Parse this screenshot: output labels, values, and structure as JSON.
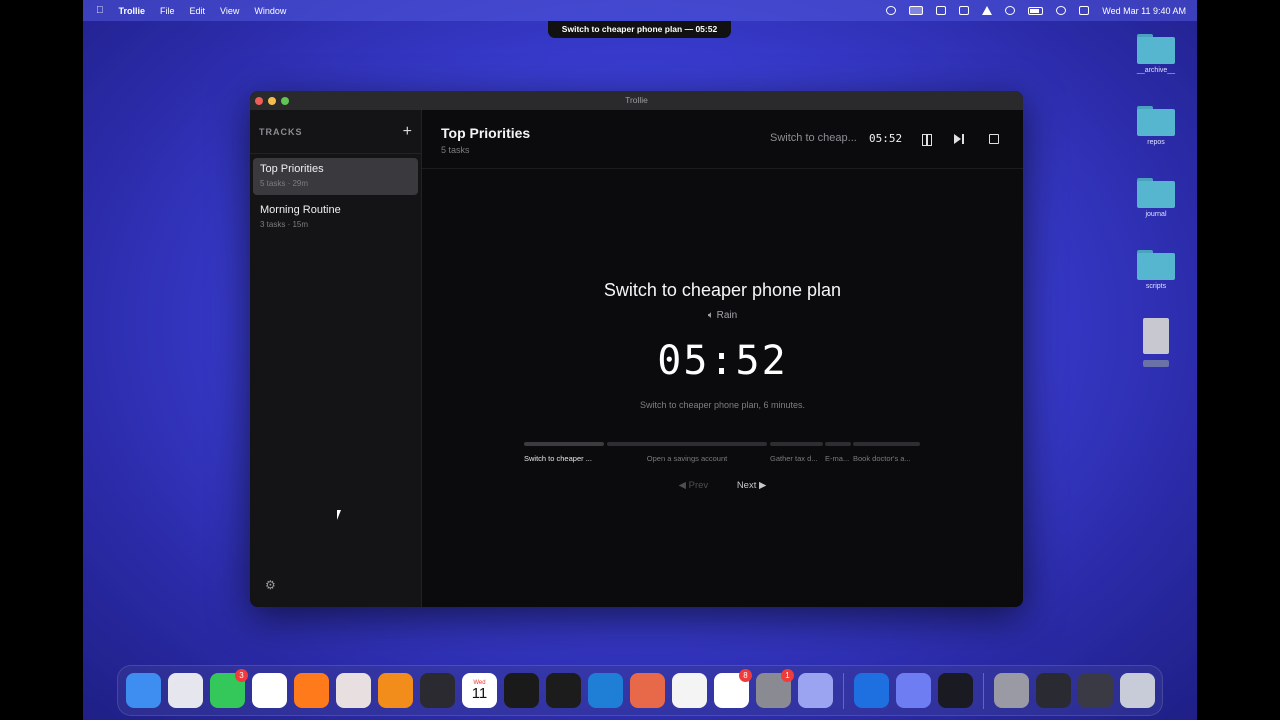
{
  "menubar": {
    "app_name": "Trollie",
    "menus": [
      "File",
      "Edit",
      "View",
      "Window"
    ],
    "datetime": "Wed Mar 11  9:40 AM"
  },
  "notification": {
    "text": "Switch to cheaper phone plan — 05:52"
  },
  "desktop": {
    "icons": [
      {
        "label": "__archive__",
        "kind": "folder"
      },
      {
        "label": "repos",
        "kind": "folder"
      },
      {
        "label": "journal",
        "kind": "folder"
      },
      {
        "label": "scripts",
        "kind": "folder"
      }
    ]
  },
  "window": {
    "title": "Trollie"
  },
  "sidebar": {
    "title": "TRACKS",
    "add_label": "+",
    "tracks": [
      {
        "name": "Top Priorities",
        "meta": "5 tasks · 29m",
        "active": true
      },
      {
        "name": "Morning Routine",
        "meta": "3 tasks · 15m",
        "active": false
      }
    ],
    "settings_icon": "gear-icon"
  },
  "main": {
    "title": "Top Priorities",
    "subtitle": "5 tasks",
    "mini_task": "Switch to cheap...",
    "mini_time": "05:52",
    "task_title": "Switch to cheaper phone plan",
    "sound_label": "Rain",
    "timer": "05:52",
    "description": "Switch to cheaper phone plan, 6 minutes.",
    "segments": [
      {
        "label": "Switch to cheaper ...",
        "current": true
      },
      {
        "label": "Open a savings account",
        "current": false
      },
      {
        "label": "Gather tax d...",
        "current": false
      },
      {
        "label": "E-ma...",
        "current": false
      },
      {
        "label": "Book doctor's a...",
        "current": false
      }
    ],
    "prev_label": "Prev",
    "next_label": "Next"
  },
  "dock": {
    "apps": [
      {
        "name": "finder-icon",
        "color": "#3d8ef0",
        "badge": ""
      },
      {
        "name": "launchpad-icon",
        "color": "#e6e6ee",
        "badge": ""
      },
      {
        "name": "messages-icon",
        "color": "#34c759",
        "badge": "3"
      },
      {
        "name": "chrome-icon",
        "color": "#ffffff",
        "badge": ""
      },
      {
        "name": "firefox-icon",
        "color": "#ff7a1a",
        "badge": ""
      },
      {
        "name": "trollie-icon",
        "color": "#e8e0e0",
        "badge": ""
      },
      {
        "name": "vlc-icon",
        "color": "#f28c1a",
        "badge": ""
      },
      {
        "name": "app-dark-icon",
        "color": "#2a2a30",
        "badge": ""
      },
      {
        "name": "calendar-icon",
        "color": "#ffffff",
        "badge": ""
      },
      {
        "name": "pen-app-icon",
        "color": "#1a1a1a",
        "badge": ""
      },
      {
        "name": "cube-app-icon",
        "color": "#1c1c1c",
        "badge": ""
      },
      {
        "name": "vscode-icon",
        "color": "#1f7fd6",
        "badge": ""
      },
      {
        "name": "claude-icon",
        "color": "#e8694a",
        "badge": ""
      },
      {
        "name": "chatgpt-icon",
        "color": "#f4f4f4",
        "badge": ""
      },
      {
        "name": "reminders-icon",
        "color": "#ffffff",
        "badge": "8"
      },
      {
        "name": "system-settings-icon",
        "color": "#8a8a92",
        "badge": "1"
      },
      {
        "name": "simulator-icon",
        "color": "#9aa4f0",
        "badge": ""
      },
      {
        "name": "quicktime-icon",
        "color": "#1e6fe0",
        "badge": ""
      },
      {
        "name": "backup-icon",
        "color": "#6e7ef2",
        "badge": ""
      },
      {
        "name": "obs-icon",
        "color": "#1a1a22",
        "badge": ""
      },
      {
        "name": "screenshot-thumb-icon",
        "color": "#9a9aa4",
        "badge": ""
      },
      {
        "name": "window-thumb-icon",
        "color": "#2a2a32",
        "badge": ""
      },
      {
        "name": "window-thumb2-icon",
        "color": "#3a3a44",
        "badge": ""
      },
      {
        "name": "trash-icon",
        "color": "#c8ccd8",
        "badge": ""
      }
    ],
    "calendar_day": "11",
    "calendar_month": "Wed"
  }
}
